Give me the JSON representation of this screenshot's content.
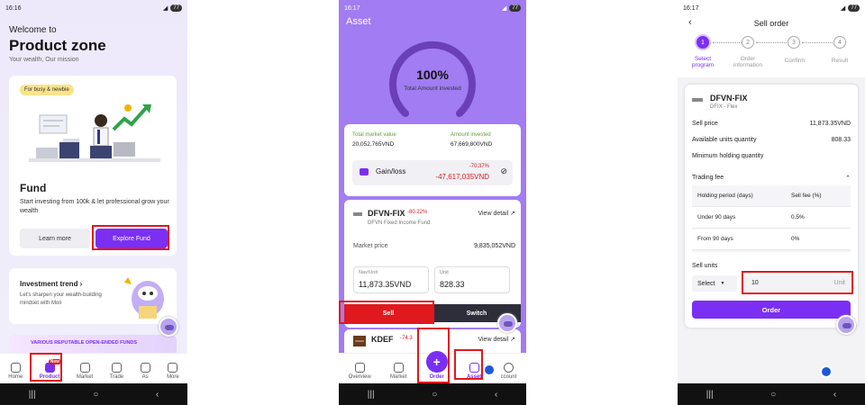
{
  "status": {
    "p1_time": "16:16",
    "p2_time": "16:17",
    "p3_time": "16:17",
    "battery": "77"
  },
  "p1": {
    "welcome": "Welcome to",
    "title": "Product zone",
    "subtitle": "Your wealth, Our mission",
    "tag": "For busy & newbie",
    "fund_title": "Fund",
    "fund_desc": "Start investing from 100k & let professional grow your wealth",
    "learn_more": "Learn more",
    "explore_fund": "Explore Fund",
    "trend_title": "Investment trend ›",
    "trend_desc": "Let's sharpen your wealth-building mindset with Moli",
    "promo": "VARIOUS REPUTABLE OPEN-ENDED FUNDS",
    "nav": [
      "Home",
      "Product",
      "Market",
      "Trade",
      "As",
      "More"
    ],
    "new_badge": "New"
  },
  "p2": {
    "asset_title": "Asset",
    "gauge_pct": "100%",
    "gauge_label": "Total Amount invested",
    "market_value_label": "Total market value",
    "market_value": "20,052,765VND",
    "amount_invested_label": "Amount invested",
    "amount_invested": "67,669,800VND",
    "gain_loss_label": "Gain/loss",
    "gain_loss_pct": "-70.37%",
    "gain_loss_value": "-47,617,035VND",
    "fund_code": "DFVN-FIX",
    "fund_change": "-80.22%",
    "fund_name": "DFVN Fixed Income Fund",
    "view_detail": "View detail ↗",
    "market_price_label": "Market price",
    "market_price": "9,835,052VND",
    "nav_unit_label": "Nav/Unit",
    "nav_unit": "11,873.35VND",
    "unit_label": "Unit",
    "unit": "828.33",
    "sell": "Sell",
    "switch": "Switch",
    "kdef_code": "KDEF",
    "kdef_change": "-74.3",
    "kdef_logo": "KIMVN",
    "nav": [
      "Overview",
      "Market",
      "Order",
      "Asset",
      "ccount"
    ]
  },
  "p3": {
    "title": "Sell order",
    "steps": [
      "1",
      "2",
      "3",
      "4"
    ],
    "step_labels": [
      "Select program",
      "Order information",
      "Confirm",
      "Result"
    ],
    "fund_code": "DFVN-FIX",
    "fund_sub": "DFIX - Flex",
    "sell_price_label": "Sell price",
    "sell_price": "11,873.35VND",
    "available_label": "Available units quantity",
    "available": "808.33",
    "min_hold_label": "Minimum holding quantity",
    "trading_fee_label": "Trading fee",
    "fee_header": [
      "Holding period (days)",
      "Sell fee (%)"
    ],
    "fee_rows": [
      [
        "Under 90 days",
        "0.5%"
      ],
      [
        "From 90 days",
        "0%"
      ]
    ],
    "sell_units_label": "Sell units",
    "select_label": "Select",
    "units_value": "10",
    "units_suffix": "Unit",
    "order_button": "Order"
  },
  "colors": {
    "accent": "#7b2ff2",
    "sell": "#e0191e",
    "highlight": "#e0191e"
  }
}
